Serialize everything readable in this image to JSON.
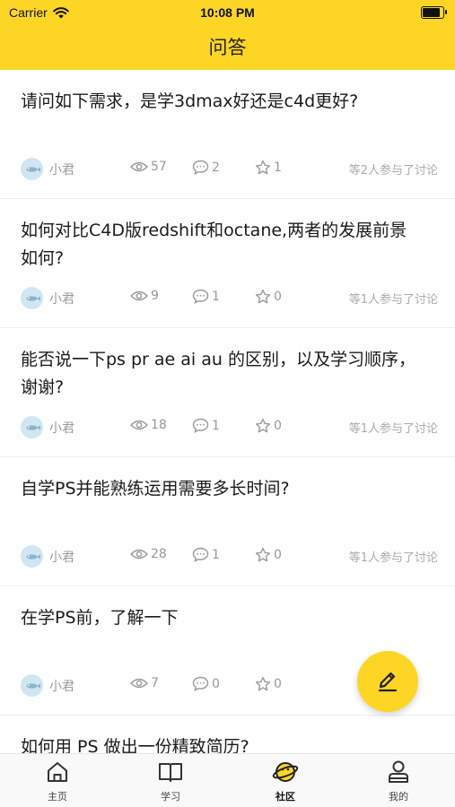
{
  "status_bar": {
    "carrier": "Carrier",
    "time": "10:08 PM"
  },
  "header": {
    "title": "问答"
  },
  "questions": [
    {
      "title": "请问如下需求，是学3dmax好还是c4d更好?",
      "author": "小君",
      "views": "57",
      "comments": "2",
      "likes": "1",
      "participants": "等2人参与了讨论"
    },
    {
      "title": "如何对比C4D版redshift和octane,两者的发展前景如何?",
      "author": "小君",
      "views": "9",
      "comments": "1",
      "likes": "0",
      "participants": "等1人参与了讨论"
    },
    {
      "title": "能否说一下ps pr ae ai au 的区别，以及学习顺序，谢谢?",
      "author": "小君",
      "views": "18",
      "comments": "1",
      "likes": "0",
      "participants": "等1人参与了讨论"
    },
    {
      "title": "自学PS并能熟练运用需要多长时间?",
      "author": "小君",
      "views": "28",
      "comments": "1",
      "likes": "0",
      "participants": "等1人参与了讨论"
    },
    {
      "title": "在学PS前，了解一下",
      "author": "小君",
      "views": "7",
      "comments": "0",
      "likes": "0",
      "participants": ""
    },
    {
      "title": "如何用 PS 做出一份精致简历?",
      "author": "",
      "views": "",
      "comments": "",
      "likes": "",
      "participants": ""
    }
  ],
  "fab": {
    "icon": "pencil-icon"
  },
  "tabbar": {
    "items": [
      {
        "label": "主页",
        "icon": "home-icon"
      },
      {
        "label": "学习",
        "icon": "book-icon"
      },
      {
        "label": "社区",
        "icon": "planet-icon"
      },
      {
        "label": "我的",
        "icon": "user-icon"
      }
    ]
  },
  "colors": {
    "accent": "#FDD625",
    "muted_text": "#999999",
    "avatar_bg": "#cfe6f3"
  }
}
